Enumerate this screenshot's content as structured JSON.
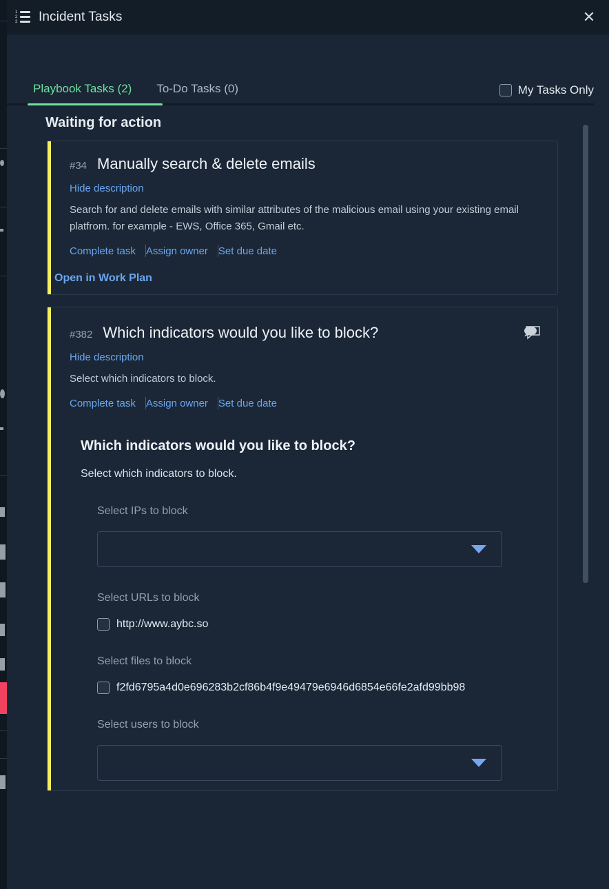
{
  "window": {
    "icon": "numbered-list-icon",
    "title": "Incident Tasks",
    "close_label": "✕"
  },
  "tabs": {
    "items": [
      {
        "label": "Playbook Tasks (2)",
        "active": true
      },
      {
        "label": "To-Do Tasks (0)",
        "active": false
      }
    ],
    "my_tasks_only_label": "My Tasks Only",
    "my_tasks_only_checked": false,
    "active_color": "#6fe0a0"
  },
  "section": {
    "title": "Waiting for action"
  },
  "tasks": [
    {
      "id": "#34",
      "title": "Manually search & delete emails",
      "toggle_description_label": "Hide description",
      "description": "Search for and delete emails with similar attributes of the malicious email using your existing email platfrom. for example - EWS, Office 365, Gmail etc.",
      "actions": [
        "Complete task",
        "Assign owner",
        "Set due date"
      ],
      "open_work_plan_label": "Open in Work Plan",
      "accent_color": "#f5ef5f",
      "has_comment_icon": false
    },
    {
      "id": "#382",
      "title": "Which indicators would you like to block?",
      "toggle_description_label": "Hide description",
      "description": "Select which indicators to block.",
      "actions": [
        "Complete task",
        "Assign owner",
        "Set due date"
      ],
      "accent_color": "#f5ef5f",
      "has_comment_icon": true,
      "comment_icon": "comment-bubble-icon"
    }
  ],
  "form": {
    "heading": "Which indicators would you like to block?",
    "subtitle": "Select which indicators to block.",
    "fields": [
      {
        "label": "Select IPs to block",
        "type": "select",
        "value": "",
        "caret_icon": "chevron-down-icon"
      },
      {
        "label": "Select URLs to block",
        "type": "checkbox",
        "value": "http://www.aybc.so",
        "checked": false
      },
      {
        "label": "Select files to block",
        "type": "checkbox",
        "value": "f2fd6795a4d0e696283b2cf86b4f9e49479e6946d6854e66fe2afd99bb98",
        "checked": false
      },
      {
        "label": "Select users to block",
        "type": "select",
        "value": ""
      }
    ]
  },
  "scrollbar": {
    "name": "vertical-scrollbar"
  }
}
